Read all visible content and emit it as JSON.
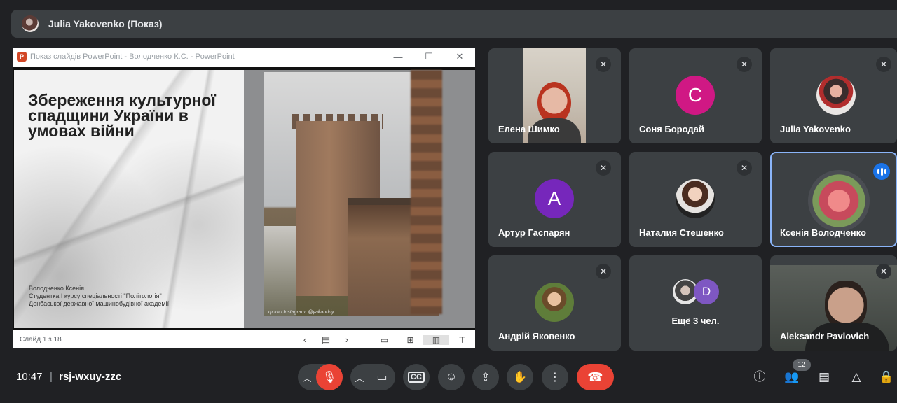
{
  "presenter_bar": {
    "name": "Julia Yakovenko (Показ)"
  },
  "presentation": {
    "window_title": "Показ слайдів PowerPoint  -  Володченко К.С. - PowerPoint",
    "heading": "Збереження культурної спадщини України в умовах війни",
    "author_lines": [
      "Володченко Ксенія",
      "Студентка І курсу спеціальності \"Політологія\"",
      "Донбаської державної машинобудівної академії"
    ],
    "photo_caption": "фото Instagram: @yakandriy",
    "slide_counter": "Слайд 1 з 18"
  },
  "participants": [
    {
      "name": "Елена Шимко",
      "type": "camera",
      "muted": true
    },
    {
      "name": "Соня Бородай",
      "type": "letter",
      "letter": "C",
      "muted": true
    },
    {
      "name": "Julia Yakovenko",
      "type": "photo",
      "muted": true
    },
    {
      "name": "Артур Гаспарян",
      "type": "letter",
      "letter": "A",
      "muted": true
    },
    {
      "name": "Наталия Стешенко",
      "type": "photo",
      "muted": true
    },
    {
      "name": "Ксенія Володченко",
      "type": "photo",
      "speaking": true
    },
    {
      "name": "Андрій Яковенко",
      "type": "photo",
      "muted": true
    },
    {
      "more_letter": "D",
      "label": "Ещё 3 чел."
    },
    {
      "name": "Aleksandr Pavlovich",
      "type": "camera",
      "muted": true
    }
  ],
  "bottom_bar": {
    "time": "10:47",
    "separator": "|",
    "meeting_code": "rsj-wxuy-zzc",
    "participants_badge": "12"
  },
  "colors": {
    "background": "#202124",
    "tile": "#3c4043",
    "end_call": "#ea4335",
    "speaking_border": "#8ab4f8",
    "avatar_c": "#d01884",
    "avatar_a": "#7627bb"
  },
  "icons": {
    "mic_off": "mic-off-icon",
    "camera": "camera-icon",
    "captions": "captions-icon",
    "emoji": "emoji-icon",
    "present": "present-screen-icon",
    "raise_hand": "raise-hand-icon",
    "more": "more-options-icon",
    "end_call": "end-call-icon",
    "info": "info-icon",
    "people": "people-icon",
    "chat": "chat-icon",
    "activities": "activities-icon",
    "lock": "host-controls-icon"
  }
}
